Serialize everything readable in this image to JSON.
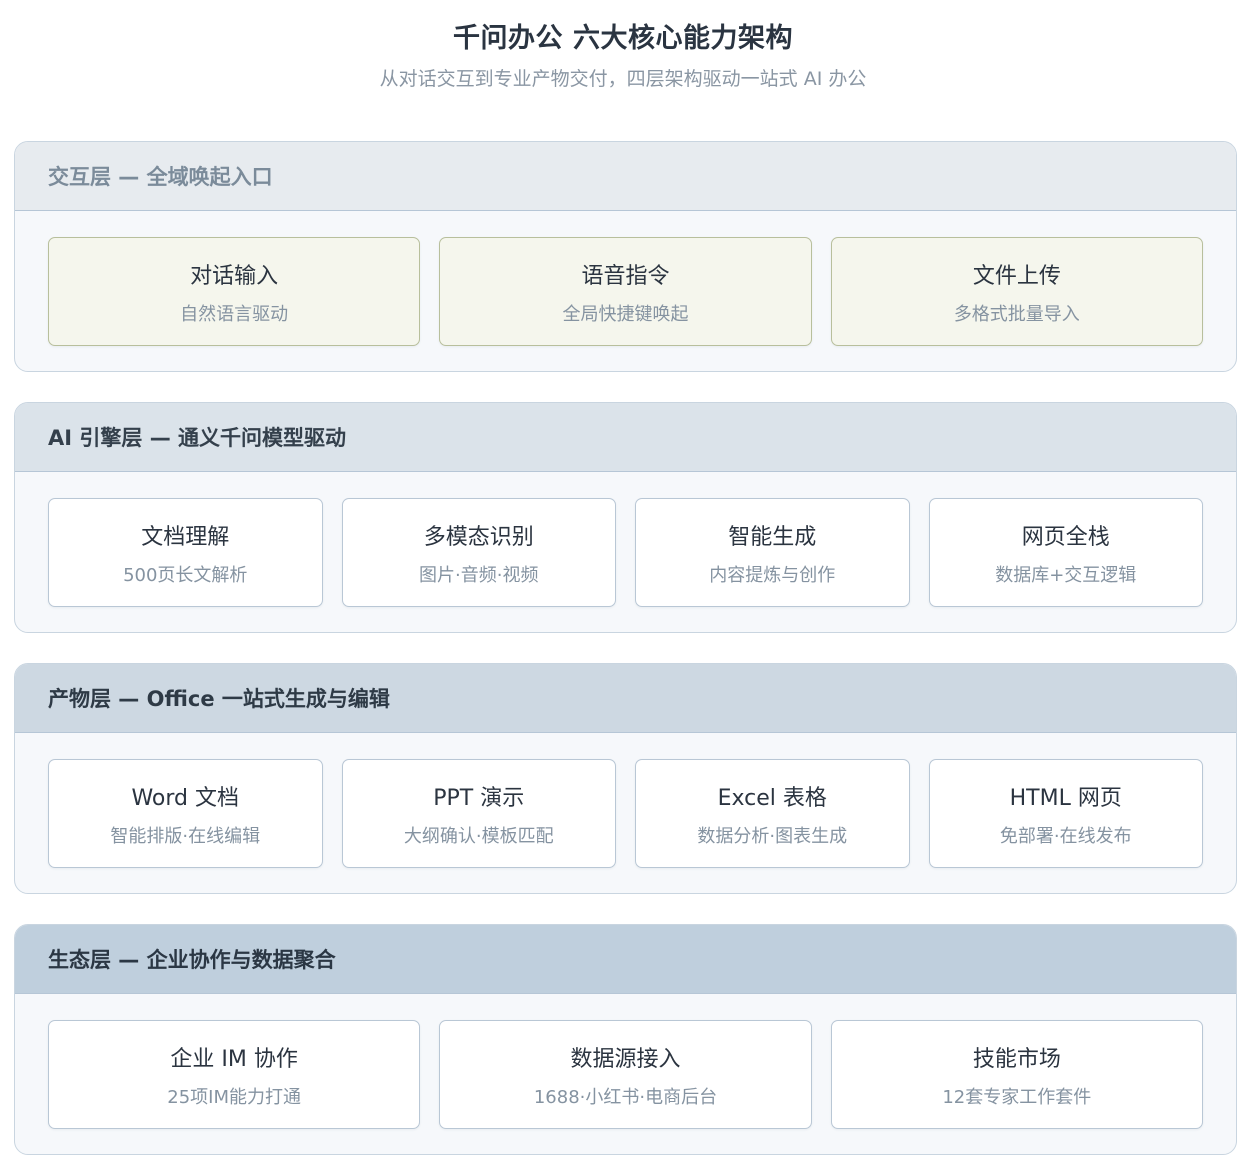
{
  "title": "千问办公 六大核心能力架构",
  "subtitle": "从对话交互到专业产物交付，四层架构驱动一站式 AI 办公",
  "colors": {
    "interaction_header": "#e7ebef",
    "interaction_card": "#f5f6ed",
    "ai_header": "#dbe3ea",
    "output_header": "#cdd8e2",
    "eco_header": "#bfcfdd"
  },
  "layers": [
    {
      "header": "交互层 — 全域唤起入口",
      "cards": [
        {
          "title": "对话输入",
          "sub": "自然语言驱动"
        },
        {
          "title": "语音指令",
          "sub": "全局快捷键唤起"
        },
        {
          "title": "文件上传",
          "sub": "多格式批量导入"
        }
      ]
    },
    {
      "header": "AI 引擎层 — 通义千问模型驱动",
      "cards": [
        {
          "title": "文档理解",
          "sub": "500页长文解析"
        },
        {
          "title": "多模态识别",
          "sub": "图片·音频·视频"
        },
        {
          "title": "智能生成",
          "sub": "内容提炼与创作"
        },
        {
          "title": "网页全栈",
          "sub": "数据库+交互逻辑"
        }
      ]
    },
    {
      "header": "产物层 — Office 一站式生成与编辑",
      "cards": [
        {
          "title": "Word 文档",
          "sub": "智能排版·在线编辑"
        },
        {
          "title": "PPT 演示",
          "sub": "大纲确认·模板匹配"
        },
        {
          "title": "Excel 表格",
          "sub": "数据分析·图表生成"
        },
        {
          "title": "HTML 网页",
          "sub": "免部署·在线发布"
        }
      ]
    },
    {
      "header": "生态层 — 企业协作与数据聚合",
      "cards": [
        {
          "title": "企业 IM 协作",
          "sub": "25项IM能力打通"
        },
        {
          "title": "数据源接入",
          "sub": "1688·小红书·电商后台"
        },
        {
          "title": "技能市场",
          "sub": "12套专家工作套件"
        }
      ]
    }
  ]
}
